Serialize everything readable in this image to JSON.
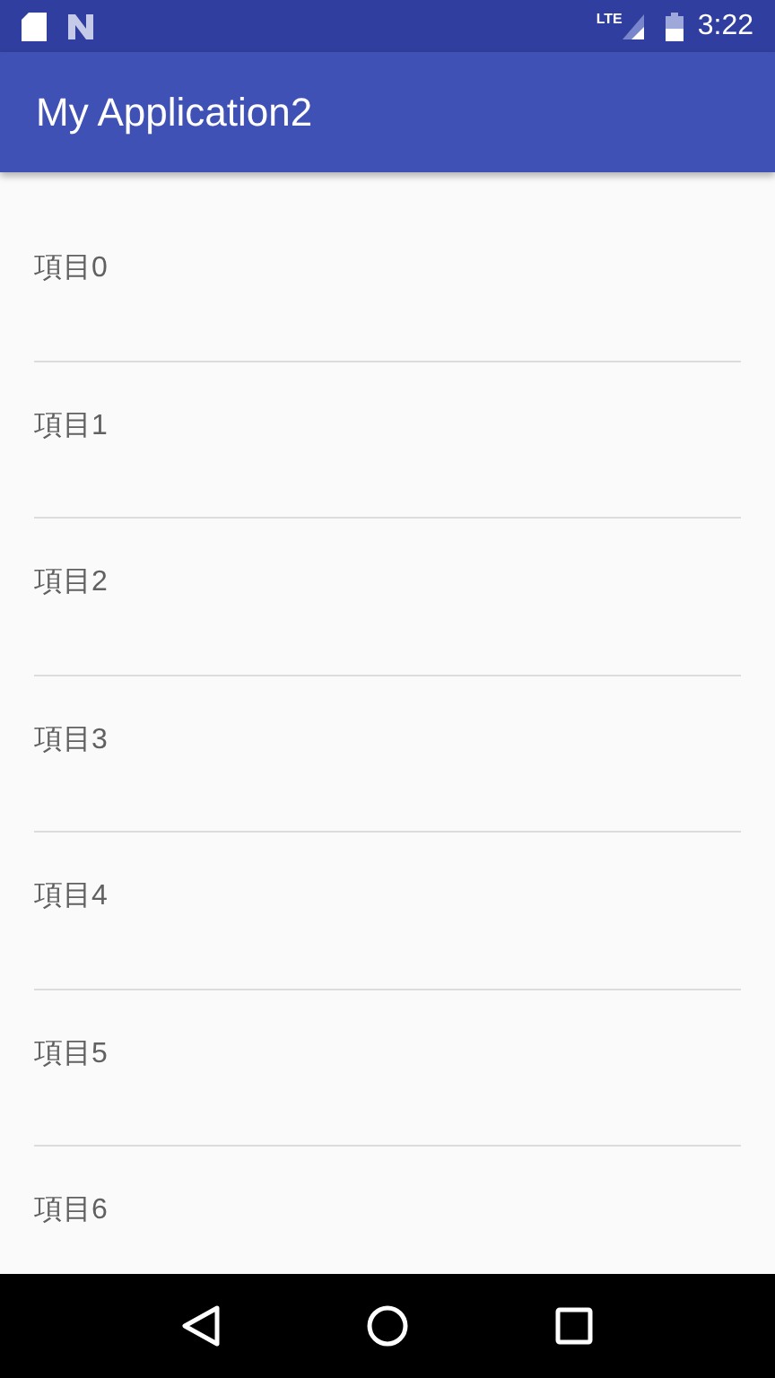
{
  "status_bar": {
    "network": "LTE",
    "time": "3:22"
  },
  "app_bar": {
    "title": "My Application2"
  },
  "items": [
    "項目0",
    "項目1",
    "項目2",
    "項目3",
    "項目4",
    "項目5",
    "項目6"
  ]
}
